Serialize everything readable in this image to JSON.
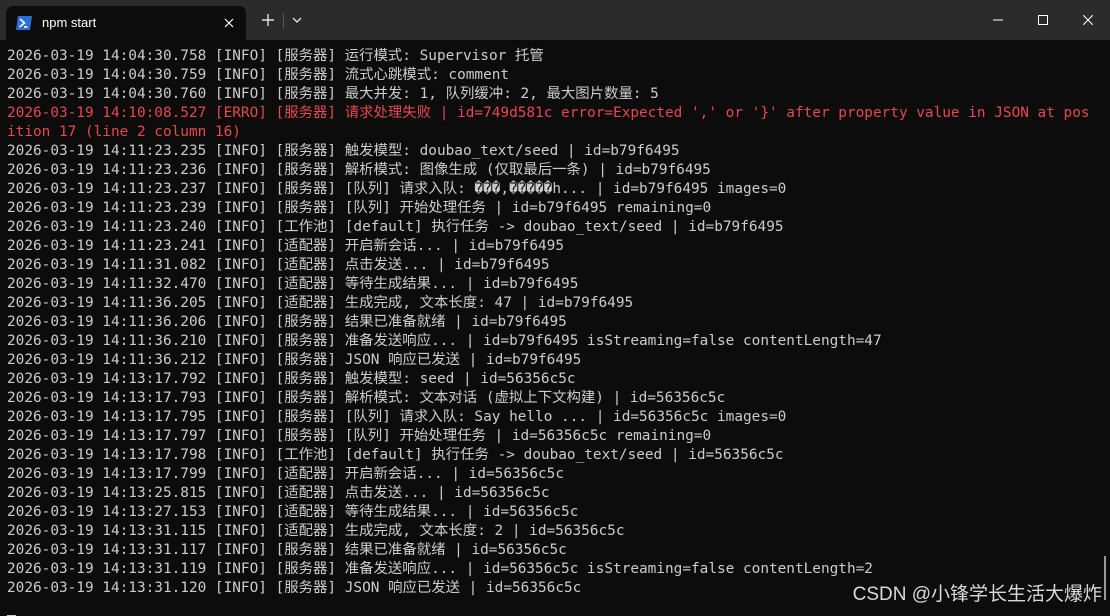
{
  "titlebar": {
    "tab_title": "npm start",
    "tab_icon": "powershell-icon",
    "new_tab_label": "+",
    "accent": "#2b2b2b"
  },
  "colors": {
    "terminal_bg": "#0c0c0c",
    "text": "#cccccc",
    "error": "#e7484e"
  },
  "terminal": {
    "lines": [
      {
        "text": "2026-03-19 14:04:30.758 [INFO] [服务器] 运行模式: Supervisor 托管",
        "level": "INFO"
      },
      {
        "text": "2026-03-19 14:04:30.759 [INFO] [服务器] 流式心跳模式: comment",
        "level": "INFO"
      },
      {
        "text": "2026-03-19 14:04:30.760 [INFO] [服务器] 最大并发: 1, 队列缓冲: 2, 最大图片数量: 5",
        "level": "INFO"
      },
      {
        "text": "2026-03-19 14:10:08.527 [ERRO] [服务器] 请求处理失败 | id=749d581c error=Expected ',' or '}' after property value in JSON at position 17 (line 2 column 16)",
        "level": "ERRO"
      },
      {
        "text": "2026-03-19 14:11:23.235 [INFO] [服务器] 触发模型: doubao_text/seed | id=b79f6495",
        "level": "INFO"
      },
      {
        "text": "2026-03-19 14:11:23.236 [INFO] [服务器] 解析模式: 图像生成 (仅取最后一条) | id=b79f6495",
        "level": "INFO"
      },
      {
        "text": "2026-03-19 14:11:23.237 [INFO] [服务器] [队列] 请求入队: ���,�����h... | id=b79f6495 images=0",
        "level": "INFO"
      },
      {
        "text": "2026-03-19 14:11:23.239 [INFO] [服务器] [队列] 开始处理任务 | id=b79f6495 remaining=0",
        "level": "INFO"
      },
      {
        "text": "2026-03-19 14:11:23.240 [INFO] [工作池] [default] 执行任务 -> doubao_text/seed | id=b79f6495",
        "level": "INFO"
      },
      {
        "text": "2026-03-19 14:11:23.241 [INFO] [适配器] 开启新会话... | id=b79f6495",
        "level": "INFO"
      },
      {
        "text": "2026-03-19 14:11:31.082 [INFO] [适配器] 点击发送... | id=b79f6495",
        "level": "INFO"
      },
      {
        "text": "2026-03-19 14:11:32.470 [INFO] [适配器] 等待生成结果... | id=b79f6495",
        "level": "INFO"
      },
      {
        "text": "2026-03-19 14:11:36.205 [INFO] [适配器] 生成完成, 文本长度: 47 | id=b79f6495",
        "level": "INFO"
      },
      {
        "text": "2026-03-19 14:11:36.206 [INFO] [服务器] 结果已准备就绪 | id=b79f6495",
        "level": "INFO"
      },
      {
        "text": "2026-03-19 14:11:36.210 [INFO] [服务器] 准备发送响应... | id=b79f6495 isStreaming=false contentLength=47",
        "level": "INFO"
      },
      {
        "text": "2026-03-19 14:11:36.212 [INFO] [服务器] JSON 响应已发送 | id=b79f6495",
        "level": "INFO"
      },
      {
        "text": "2026-03-19 14:13:17.792 [INFO] [服务器] 触发模型: seed | id=56356c5c",
        "level": "INFO"
      },
      {
        "text": "2026-03-19 14:13:17.793 [INFO] [服务器] 解析模式: 文本对话 (虚拟上下文构建) | id=56356c5c",
        "level": "INFO"
      },
      {
        "text": "2026-03-19 14:13:17.795 [INFO] [服务器] [队列] 请求入队: Say hello ... | id=56356c5c images=0",
        "level": "INFO"
      },
      {
        "text": "2026-03-19 14:13:17.797 [INFO] [服务器] [队列] 开始处理任务 | id=56356c5c remaining=0",
        "level": "INFO"
      },
      {
        "text": "2026-03-19 14:13:17.798 [INFO] [工作池] [default] 执行任务 -> doubao_text/seed | id=56356c5c",
        "level": "INFO"
      },
      {
        "text": "2026-03-19 14:13:17.799 [INFO] [适配器] 开启新会话... | id=56356c5c",
        "level": "INFO"
      },
      {
        "text": "2026-03-19 14:13:25.815 [INFO] [适配器] 点击发送... | id=56356c5c",
        "level": "INFO"
      },
      {
        "text": "2026-03-19 14:13:27.153 [INFO] [适配器] 等待生成结果... | id=56356c5c",
        "level": "INFO"
      },
      {
        "text": "2026-03-19 14:13:31.115 [INFO] [适配器] 生成完成, 文本长度: 2 | id=56356c5c",
        "level": "INFO"
      },
      {
        "text": "2026-03-19 14:13:31.117 [INFO] [服务器] 结果已准备就绪 | id=56356c5c",
        "level": "INFO"
      },
      {
        "text": "2026-03-19 14:13:31.119 [INFO] [服务器] 准备发送响应... | id=56356c5c isStreaming=false contentLength=2",
        "level": "INFO"
      },
      {
        "text": "2026-03-19 14:13:31.120 [INFO] [服务器] JSON 响应已发送 | id=56356c5c",
        "level": "INFO"
      }
    ]
  },
  "watermark": "CSDN @小锋学长生活大爆炸"
}
